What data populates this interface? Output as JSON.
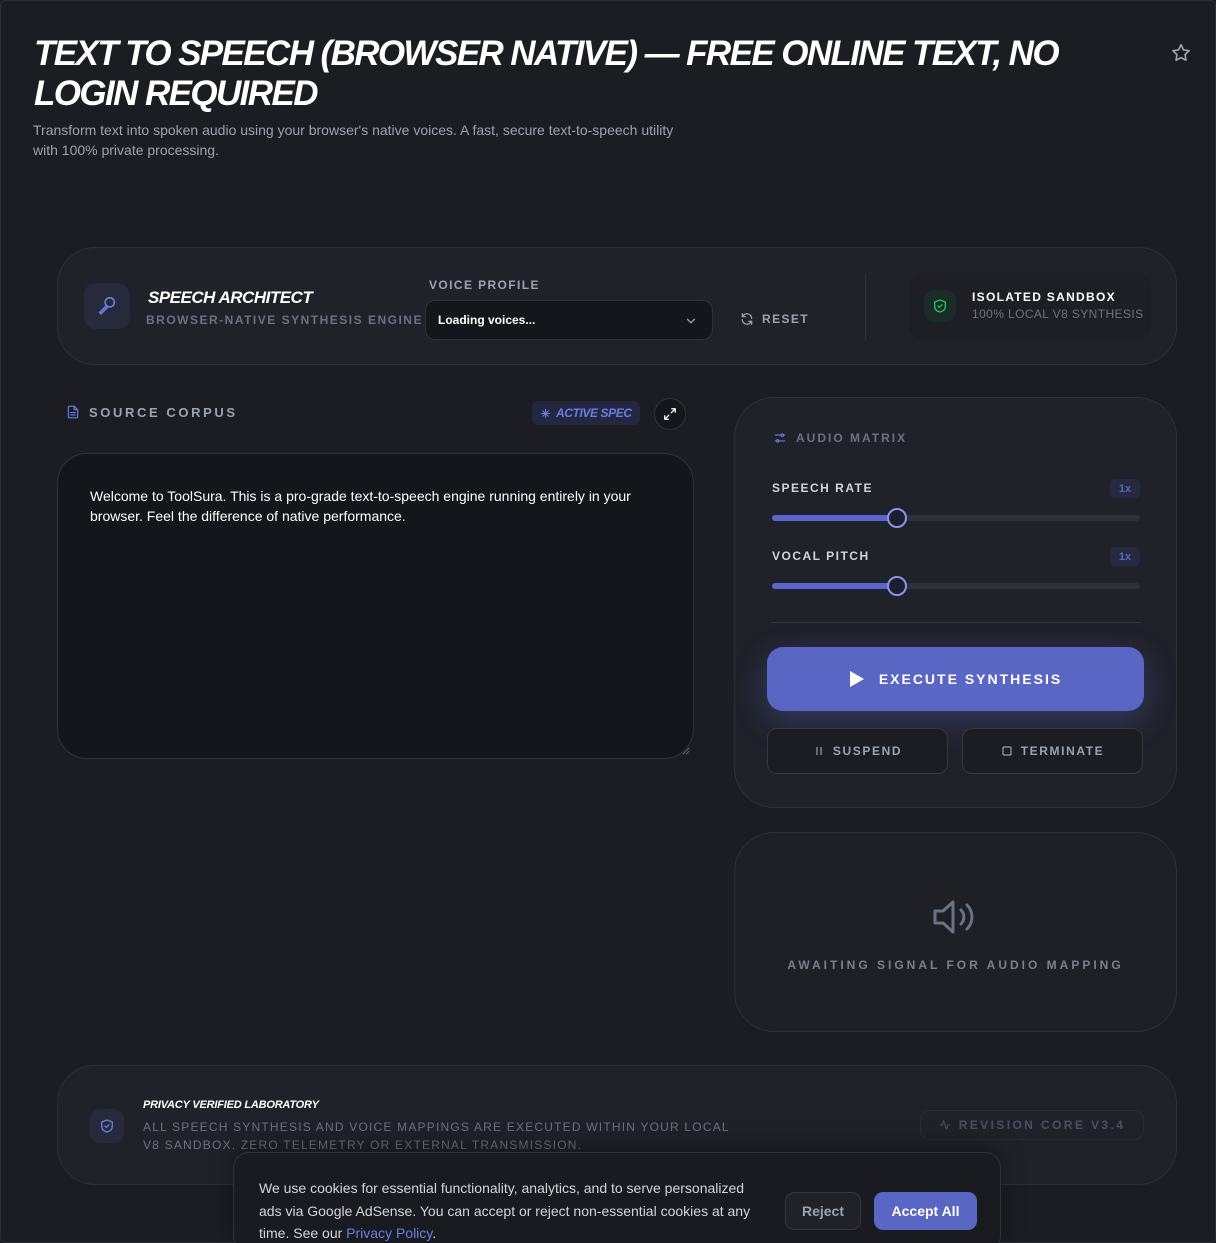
{
  "header": {
    "title": "TEXT TO SPEECH (BROWSER NATIVE) — FREE ONLINE TEXT, NO LOGIN REQUIRED",
    "subtitle": "Transform text into spoken audio using your browser's native voices. A fast, secure text-to-speech utility with 100% private processing.",
    "favorite_icon": "star-icon"
  },
  "toolbar": {
    "brand_icon": "microphone-icon",
    "brand_title": "SPEECH ARCHITECT",
    "brand_subtitle": "BROWSER-NATIVE SYNTHESIS ENGINE",
    "voice_label": "VOICE PROFILE",
    "voice_value": "Loading voices...",
    "reset_label": "RESET",
    "sandbox_title": "ISOLATED SANDBOX",
    "sandbox_subtitle": "100% LOCAL V8 SYNTHESIS"
  },
  "corpus": {
    "title": "SOURCE CORPUS",
    "badge": "ACTIVE SPEC",
    "text": "Welcome to ToolSura. This is a pro-grade text-to-speech engine running entirely in your browser. Feel the difference of native performance."
  },
  "matrix": {
    "title": "AUDIO MATRIX",
    "speech_rate_label": "SPEECH RATE",
    "speech_rate_value": "1x",
    "speech_rate_fraction": 0.34,
    "vocal_pitch_label": "VOCAL PITCH",
    "vocal_pitch_value": "1x",
    "vocal_pitch_fraction": 0.34,
    "execute_label": "EXECUTE SYNTHESIS",
    "suspend_label": "SUSPEND",
    "terminate_label": "TERMINATE"
  },
  "signal": {
    "text": "AWAITING SIGNAL FOR AUDIO MAPPING"
  },
  "privacy": {
    "title": "PRIVACY VERIFIED LABORATORY",
    "description": "ALL SPEECH SYNTHESIS AND VOICE MAPPINGS ARE EXECUTED WITHIN YOUR LOCAL V8 SANDBOX. ZERO TELEMETRY OR EXTERNAL TRANSMISSION.",
    "revision": "REVISION CORE V3.4"
  },
  "cookie": {
    "text": "We use cookies for essential functionality, analytics, and to serve personalized ads via Google AdSense. You can accept or reject non-essential cookies at any time. See our ",
    "link": "Privacy Policy",
    "period": ".",
    "reject": "Reject",
    "accept": "Accept All"
  },
  "colors": {
    "background": "#1c1d22",
    "card": "#20222a",
    "accent": "#5a66c4",
    "accent_text": "#6b7de0",
    "success": "#22c55e"
  }
}
